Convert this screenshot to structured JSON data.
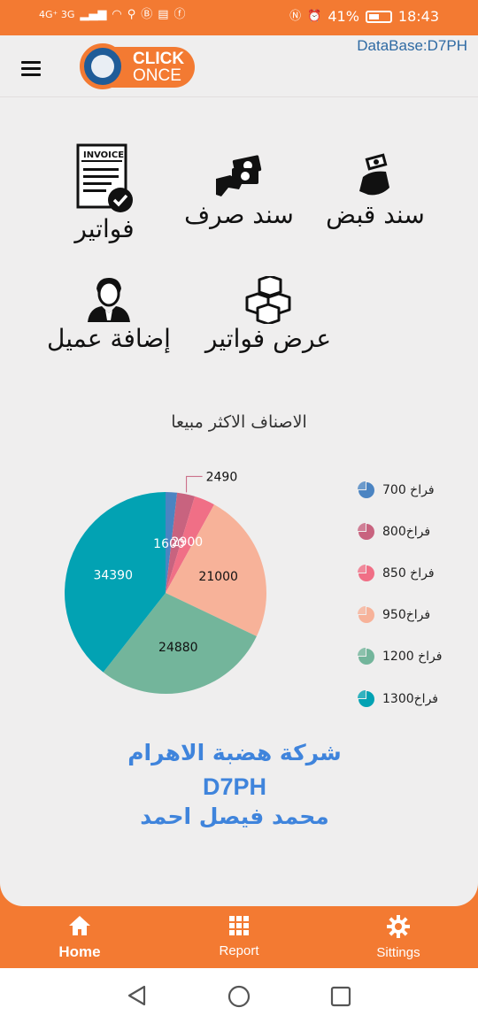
{
  "status_bar": {
    "network_left": "4G⁺ 3G",
    "battery": "41%",
    "time": "18:43"
  },
  "app_bar": {
    "logo_line1": "CLICK",
    "logo_line2": "ONCE",
    "database_label": "DataBase:D7PH"
  },
  "actions": {
    "invoice_icon_text": "INVOICE",
    "receipt_voucher": "سند قبض",
    "payment_voucher": "سند صرف",
    "invoices": "فواتير",
    "view_invoices": "عرض فواتير",
    "add_customer": "إضافة عميل"
  },
  "chart_data": {
    "type": "pie",
    "title": "الاصناف الاكثر مبيعا",
    "slices": [
      {
        "label": "فراخ 700",
        "value": 1600,
        "color": "#4b84c2"
      },
      {
        "label": "فراخ800",
        "value": 2490,
        "color": "#c8637f"
      },
      {
        "label": "فراخ 850",
        "value": 2900,
        "color": "#f06f86"
      },
      {
        "label": "فراخ950",
        "value": 21000,
        "color": "#f7b299"
      },
      {
        "label": "فراخ 1200",
        "value": 24880,
        "color": "#73b59b"
      },
      {
        "label": "فراخ1300",
        "value": 34390,
        "color": "#02a2b3"
      }
    ],
    "legend_position": "right"
  },
  "company": {
    "name": "شركة هضبة الاهرام",
    "code": "D7PH",
    "user": "محمد فيصل احمد"
  },
  "bottom_nav": {
    "home": "Home",
    "report": "Report",
    "settings": "Sittings"
  }
}
